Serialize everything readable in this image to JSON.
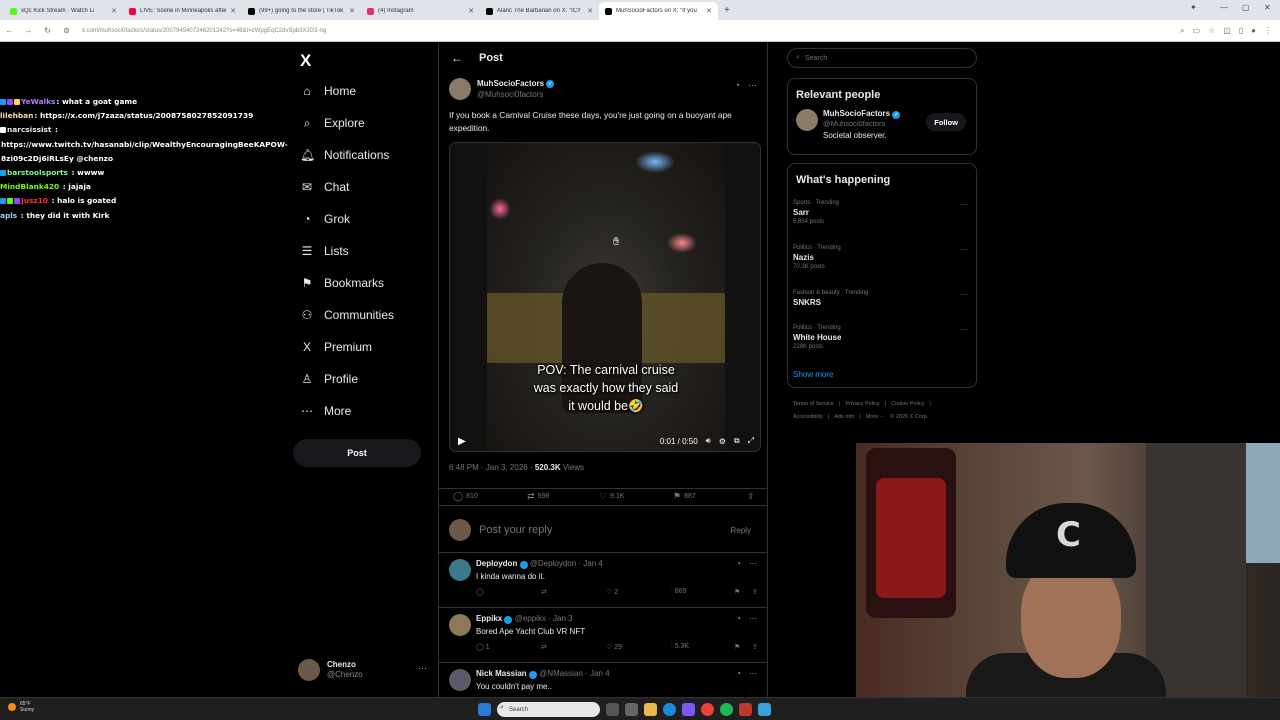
{
  "browser": {
    "tabs": [
      {
        "title": "xQc Kick Stream · Watch Li",
        "color": "#53fc18"
      },
      {
        "title": "LIVE: Scene in Minneapolis after",
        "color": "#ff0033"
      },
      {
        "title": "(99+) going to the store | TikTok",
        "color": "#000000"
      },
      {
        "title": "(4) Instagram",
        "color": "#e1306c"
      },
      {
        "title": "Alaric The Barbarian on X: \"ICY",
        "color": "#000000"
      },
      {
        "title": "MuhSocioFactors on X: \"If you",
        "color": "#000000"
      }
    ],
    "active_tab": 5,
    "url": "x.com/muhsoci0factors/status/2007945407246201242?s=46&t=zWpgEqC2dvSpb3XJG3-ng"
  },
  "chat": [
    {
      "user": "YeWalks",
      "text": ": what a goat game",
      "color": "#b67cff",
      "badges": [
        "#1d9bf0",
        "#9146ff",
        "#ffd54a"
      ]
    },
    {
      "user": "lilehban",
      "text": ": https://x.com/j7zaza/status/2008758027852091739",
      "color": "#ffdab3",
      "badges": []
    },
    {
      "user": "narcsissist",
      "text": " :",
      "color": "#e7e9ea",
      "badges": [
        "#ffffff"
      ]
    },
    {
      "user": "",
      "text": "https://www.twitch.tv/hasanabi/clip/WealthyEncouragingBeeKAPOW-",
      "color": "#e7e9ea",
      "badges": []
    },
    {
      "user": "",
      "text": "8zi09c2Dj6iRLsEy @chenzo",
      "color": "#e7e9ea",
      "badges": []
    },
    {
      "user": "barstoolsports",
      "text": " : wwww",
      "color": "#7cfc8a",
      "badges": [
        "#1d9bf0"
      ]
    },
    {
      "user": "MindBlank420",
      "text": " : jajaja",
      "color": "#7cfc00",
      "badges": []
    },
    {
      "user": "Jusz10",
      "text": " : halo is goated",
      "color": "#ff3040",
      "badges": [
        "#1d9bf0",
        "#53fc18",
        "#9146ff"
      ]
    },
    {
      "user": "apls",
      "text": " : they did it with Kirk",
      "color": "#9ad0ff",
      "badges": []
    }
  ],
  "nav": {
    "items": [
      {
        "label": "Home",
        "icon": "⌂",
        "name": "home"
      },
      {
        "label": "Explore",
        "icon": "⌕",
        "name": "explore"
      },
      {
        "label": "Notifications",
        "icon": "🔔︎",
        "name": "notifications"
      },
      {
        "label": "Chat",
        "icon": "✉",
        "name": "chat"
      },
      {
        "label": "Grok",
        "icon": "◔",
        "name": "grok"
      },
      {
        "label": "Lists",
        "icon": "☰",
        "name": "lists"
      },
      {
        "label": "Bookmarks",
        "icon": "⚑",
        "name": "bookmarks"
      },
      {
        "label": "Communities",
        "icon": "⚇",
        "name": "communities"
      },
      {
        "label": "Premium",
        "icon": "X",
        "name": "premium"
      },
      {
        "label": "Profile",
        "icon": "♙",
        "name": "profile"
      },
      {
        "label": "More",
        "icon": "⋯",
        "name": "more"
      }
    ],
    "post_label": "Post",
    "account": {
      "name": "Chenzo",
      "handle": "@Chenzo"
    }
  },
  "post": {
    "header": "Post",
    "author": {
      "name": "MuhSocioFactors",
      "handle": "@Muhsoci0factors"
    },
    "text": "If you book a Carnival Cruise these days, you're just going on a buoyant ape expedition.",
    "video_caption": [
      "POV: The carnival cruise",
      "was exactly how they said",
      "it would be🤣"
    ],
    "video_time": "0:01 / 0:50",
    "timestamp": "6:48 PM · Jan 3, 2026 · ",
    "views": "520.3K",
    "views_label": " Views",
    "stats": {
      "replies": "810",
      "reposts": "598",
      "likes": "9.1K",
      "bookmarks": "887"
    },
    "reply_placeholder": "Post your reply",
    "reply_button": "Reply"
  },
  "replies": [
    {
      "name": "Deploydon",
      "handle": "@Deploydon · Jan 4",
      "text": "I kinda wanna do it.",
      "replies": "",
      "reposts": "",
      "likes": "2",
      "views": "869",
      "color": "#3a7a8a"
    },
    {
      "name": "Eppikx",
      "handle": "@eppikx · Jan 3",
      "text": "Bored Ape Yacht Club VR NFT",
      "replies": "1",
      "reposts": "",
      "likes": "29",
      "views": "5.3K",
      "color": "#8a7a5a"
    },
    {
      "name": "Nick Massian",
      "handle": "@NMassian · Jan 4",
      "text": "You couldn't pay me..",
      "replies": "",
      "reposts": "",
      "likes": "",
      "views": "",
      "color": "#5a5a6a"
    }
  ],
  "sidebar": {
    "search_placeholder": "Search",
    "relevant_title": "Relevant people",
    "relevant": {
      "name": "MuhSocioFactors",
      "handle": "@Muhsoci0factors",
      "bio": "Societal observer.",
      "follow": "Follow"
    },
    "happening_title": "What's happening",
    "trends": [
      {
        "category": "Sports · Trending",
        "name": "Sarr",
        "posts": "6,854 posts"
      },
      {
        "category": "Politics · Trending",
        "name": "Nazis",
        "posts": "70.3K posts"
      },
      {
        "category": "Fashion & beauty · Trending",
        "name": "SNKRS",
        "posts": ""
      },
      {
        "category": "Politics · Trending",
        "name": "White House",
        "posts": "228K posts"
      }
    ],
    "show_more": "Show more",
    "footer1": [
      "Terms of Service",
      "|",
      "Privacy Policy",
      "|",
      "Cookie Policy",
      "|"
    ],
    "footer2": [
      "Accessibility",
      "|",
      "Ads info",
      "|",
      "More ···",
      "© 2026 X Corp."
    ]
  },
  "taskbar": {
    "temp": "65°F",
    "weather": "Sunny",
    "search": "Search"
  }
}
